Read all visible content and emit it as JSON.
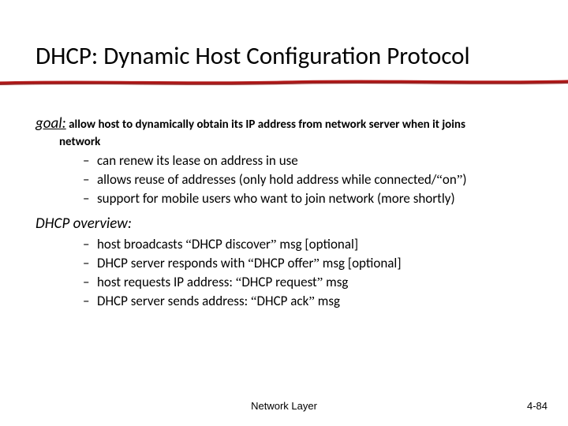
{
  "title": "DHCP: Dynamic Host Configuration Protocol",
  "goal": {
    "lead": "goal:",
    "text": " allow host to dynamically obtain its IP address from network server when it joins",
    "tail": "network",
    "bullets": [
      "can renew its lease on address in use",
      "allows reuse of addresses (only hold address while connected/“on”)",
      "support for mobile users who want to join network (more shortly)"
    ]
  },
  "overview": {
    "head": "DHCP overview:",
    "bullets": [
      "host broadcasts “DHCP discover” msg [optional]",
      "DHCP server responds with “DHCP offer” msg [optional]",
      "host requests IP address: “DHCP request” msg",
      "DHCP server sends address: “DHCP ack” msg"
    ]
  },
  "footer": {
    "center": "Network Layer",
    "right": "4-84"
  }
}
